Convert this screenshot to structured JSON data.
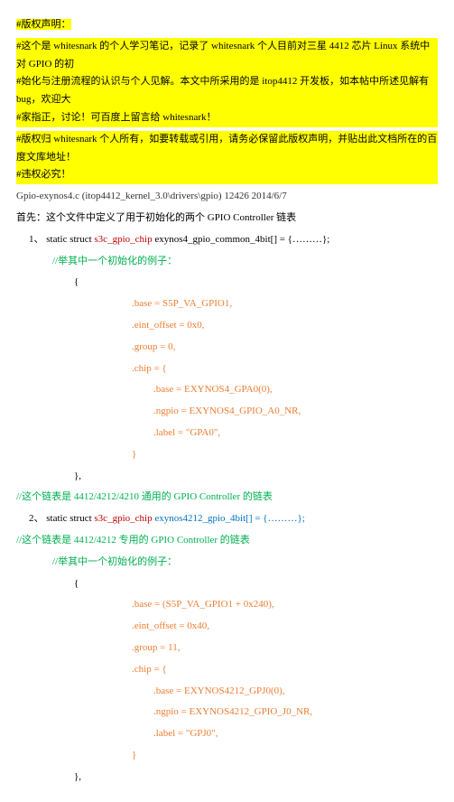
{
  "header": {
    "l1": "#版权声明：",
    "l2a": "#这个是 whitesnark 的个人学习笔记，记录了 whitesnark 个人目前对三星 4412 芯片 Linux 系统中对 GPIO 的初",
    "l2b": "#始化与注册流程的认识与个人见解。本文中所采用的是 itop4412 开发板，如本帖中所述见解有 bug，欢迎大",
    "l2c": "#家指正，讨论！可百度上留言给 whitesnark！",
    "l3a": "#版权归 whitesnark 个人所有，如要转载或引用，请务必保留此版权声明，并贴出此文档所在的百度文库地址！",
    "l3b": "#违权必究！"
  },
  "fileinfo": "Gpio-exynos4.c (itop4412_kernel_3.0\\drivers\\gpio) 12426  2014/6/7",
  "intro": "首先：这个文件中定义了用于初始化的两个 GPIO Controller 链表",
  "s1": {
    "num": "1、",
    "pre": "static struct ",
    "type": "s3c_gpio_chip",
    "post": " exynos4_gpio_common_4bit[] = {………};",
    "comment": "//举其中一个初始化的例子：",
    "open": "{",
    "base": ".base    = S5P_VA_GPIO1,",
    "eint": ".eint_offset = 0x0,",
    "group": ".group = 0,",
    "chipopen": ".chip    = {",
    "cbase": ".base   = EXYNOS4_GPA0(0),",
    "ngpio": ".ngpio  = EXYNOS4_GPIO_A0_NR,",
    "label": ".label   = \"GPA0\",",
    "cclose": "}",
    "close": "},",
    "tail": "//这个链表是 4412/4212/4210 通用的 GPIO Controller 的链表"
  },
  "s2": {
    "num": "2、",
    "pre": "static struct ",
    "type": "s3c_gpio_chip",
    "post": " exynos4212_gpio_4bit[] = {………};",
    "tail": "//这个链表是 4412/4212 专用的 GPIO Controller 的链表",
    "comment": "//举其中一个初始化的例子：",
    "open": "{",
    "base": ".base     = (S5P_VA_GPIO1 + 0x240),",
    "eint": ".eint_offset = 0x40,",
    "group": ".group = 11,",
    "chipopen": ".chip   = {",
    "cbase": ".base   = EXYNOS4212_GPJ0(0),",
    "ngpio": ".ngpio = EXYNOS4212_GPIO_J0_NR,",
    "label": ".label  = \"GPJ0\",",
    "cclose": "}",
    "close": "},"
  }
}
